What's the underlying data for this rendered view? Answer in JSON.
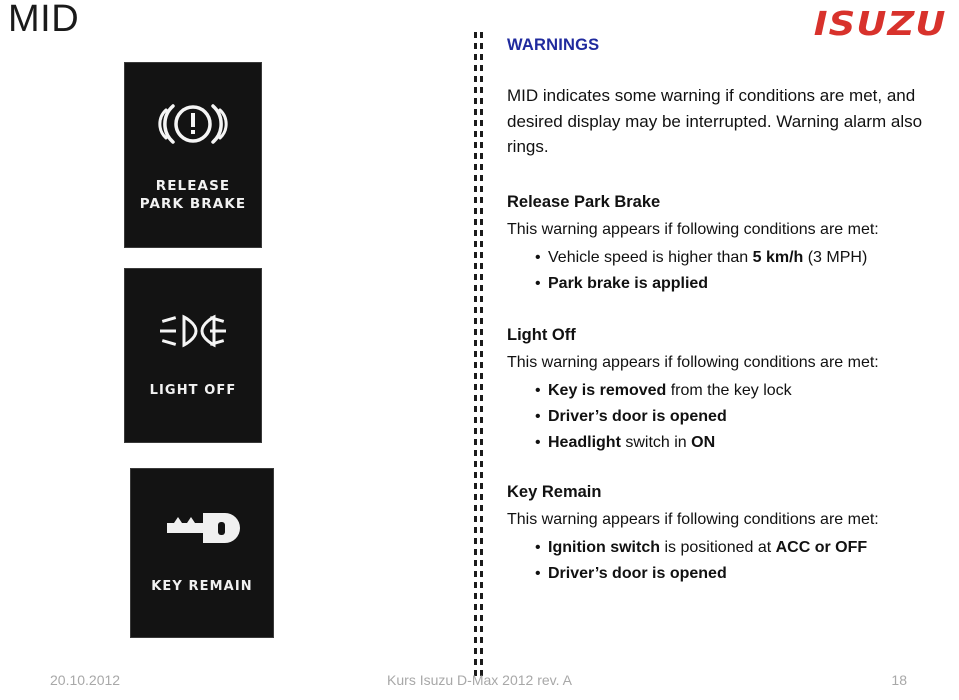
{
  "header": {
    "title": "MID",
    "logo_text": "ISUZU",
    "logo_color": "#d8322c"
  },
  "mid_panels": [
    {
      "icon_name": "park-brake-warning-icon",
      "caption_line1": "RELEASE",
      "caption_line2": "PARK BRAKE"
    },
    {
      "icon_name": "headlight-off-icon",
      "caption_line1": "LIGHT OFF",
      "caption_line2": ""
    },
    {
      "icon_name": "key-icon",
      "caption_line1": "KEY REMAIN",
      "caption_line2": ""
    }
  ],
  "content": {
    "warnings_heading": "WARNINGS",
    "warnings_heading_color": "#1f2a9e",
    "intro_paragraph": "MID indicates some warning if conditions are met, and desired display may be interrupted. Warning alarm also rings.",
    "blocks": [
      {
        "heading": "Release Park Brake",
        "subline": "This warning appears if following conditions are met:",
        "conditions": [
          {
            "parts": [
              {
                "text": "Vehicle speed is higher than ",
                "bold": false
              },
              {
                "text": "5 km/h",
                "bold": true
              },
              {
                "text": " (3 MPH)",
                "bold": false
              }
            ]
          },
          {
            "parts": [
              {
                "text": "Park brake is applied",
                "bold": true
              }
            ]
          }
        ]
      },
      {
        "heading": "Light Off",
        "subline": "This warning appears if following conditions are met:",
        "conditions": [
          {
            "parts": [
              {
                "text": "Key is removed",
                "bold": true
              },
              {
                "text": " from the key lock",
                "bold": false
              }
            ]
          },
          {
            "parts": [
              {
                "text": "Driver’s door is opened",
                "bold": true
              }
            ]
          },
          {
            "parts": [
              {
                "text": "Headlight",
                "bold": true
              },
              {
                "text": " switch in ",
                "bold": false
              },
              {
                "text": "ON",
                "bold": true
              }
            ]
          }
        ]
      },
      {
        "heading": "Key Remain",
        "subline": "This warning appears if following conditions are met:",
        "conditions": [
          {
            "parts": [
              {
                "text": "Ignition switch",
                "bold": true
              },
              {
                "text": " is positioned at ",
                "bold": false
              },
              {
                "text": "ACC or OFF",
                "bold": true
              }
            ]
          },
          {
            "parts": [
              {
                "text": "Driver’s door is opened",
                "bold": true
              }
            ]
          }
        ]
      }
    ]
  },
  "footer": {
    "date": "20.10.2012",
    "center_text": "Kurs Isuzu D-Max 2012 rev. A",
    "page_number": "18"
  }
}
